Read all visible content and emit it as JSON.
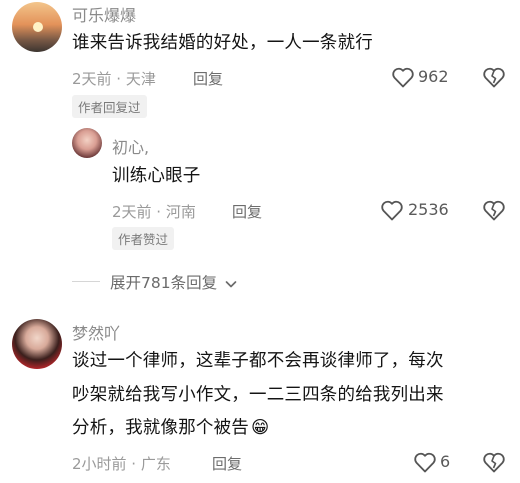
{
  "comments": [
    {
      "username": "可乐爆爆",
      "text": "谁来告诉我结婚的好处，一人一条就行",
      "meta": "2天前 · 天津",
      "reply_label": "回复",
      "like_count": "962",
      "badge": "作者回复过"
    },
    {
      "username": "梦然吖",
      "text_lines": [
        "谈过一个律师，这辈子都不会再谈律师了，每次",
        "吵架就给我写小作文，一二三四条的给我列出来",
        "分析，我就像那个被告"
      ],
      "emoji": "😁",
      "meta": "2小时前 · 广东",
      "reply_label": "回复",
      "like_count": "6"
    }
  ],
  "reply": {
    "username": "初心,",
    "text": "训练心眼子",
    "meta": "2天前 · 河南",
    "reply_label": "回复",
    "like_count": "2536",
    "badge": "作者赞过"
  },
  "expand_label": "展开781条回复",
  "icons": [
    "heart-icon",
    "broken-heart-icon",
    "chevron-down-icon"
  ]
}
